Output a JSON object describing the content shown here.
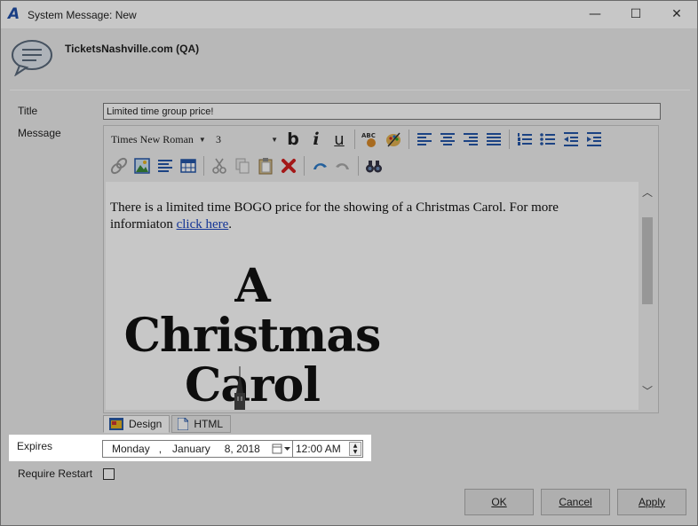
{
  "window": {
    "title": "System Message: New",
    "minimize": "—",
    "maximize": "☐",
    "close": "✕"
  },
  "header": {
    "org_name": "TicketsNashville.com (QA)"
  },
  "form": {
    "title_label": "Title",
    "title_value": "Limited time group price!",
    "message_label": "Message",
    "expires_label": "Expires",
    "require_restart_label": "Require Restart",
    "require_restart_checked": false
  },
  "toolbar": {
    "font_name": "Times New Roman",
    "font_size": "3"
  },
  "editor": {
    "body_text": "There is a limited time BOGO price for the showing of a Christmas Carol. For more informiaton",
    "link_text": "click here",
    "after_link": ".",
    "image_title_line1": "A Christmas",
    "image_title_line2": "Carol",
    "tabs": [
      "Design",
      "HTML"
    ],
    "active_tab": "Design"
  },
  "expires": {
    "weekday": "Monday",
    "sep": ",",
    "month": "January",
    "day_year": "8, 2018",
    "time": "12:00 AM"
  },
  "buttons": {
    "ok": "OK",
    "cancel": "Cancel",
    "apply": "Apply"
  }
}
